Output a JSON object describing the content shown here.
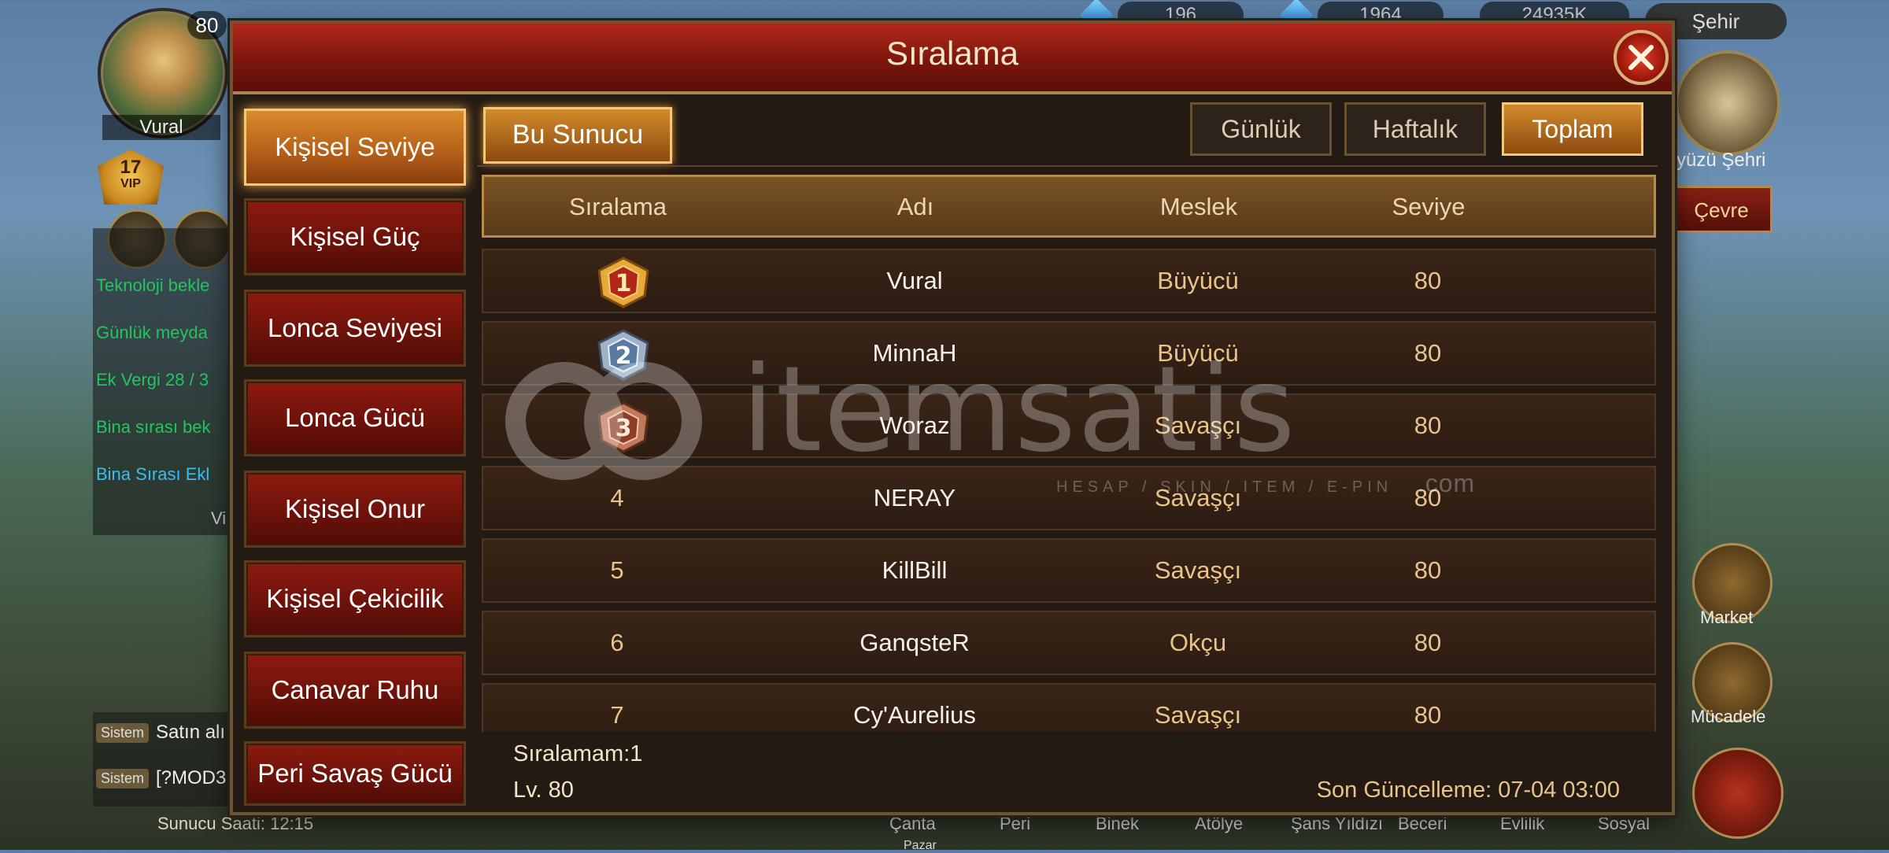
{
  "hud": {
    "player_level": "80",
    "player_name": "Vural",
    "vip_level": "17",
    "vip_label": "VIP",
    "resources": [
      "196",
      "1964",
      "24935K"
    ],
    "city_chip": "Şehir",
    "city_name": "kyüzü Şehri",
    "cevre_button": "Çevre",
    "quests": [
      {
        "text": "Teknoloji bekle",
        "color": "#22c55e"
      },
      {
        "text": "Günlük meyda",
        "color": "#22c55e"
      },
      {
        "text": "Ek Vergi 28 / 3",
        "color": "#22c55e"
      },
      {
        "text": "Bina sırası bek",
        "color": "#22c55e"
      },
      {
        "text": "Bina Sırası Ekl",
        "color": "#38bdf8"
      },
      {
        "text": "Vi",
        "color": "#cccccc"
      }
    ],
    "chat": [
      {
        "tag": "Sistem",
        "text": "Satın alı"
      },
      {
        "tag": "Sistem",
        "text": "[?MOD3"
      }
    ],
    "server_time": "Sunucu Saati: 12:15",
    "side_buttons": [
      "Market",
      "Mücadele"
    ],
    "bottom_menu": [
      "Çanta",
      "Peri",
      "Binek",
      "Atölye",
      "Şans Yıldızı",
      "Beceri",
      "Evlilik",
      "Sosyal"
    ],
    "bottom_extra": "Pazar"
  },
  "modal": {
    "title": "Sıralama",
    "sidebar": [
      {
        "label": "Kişisel Seviye",
        "active": true
      },
      {
        "label": "Kişisel Güç",
        "active": false
      },
      {
        "label": "Lonca Seviyesi",
        "active": false
      },
      {
        "label": "Lonca Gücü",
        "active": false
      },
      {
        "label": "Kişisel Onur",
        "active": false
      },
      {
        "label": "Kişisel Çekicilik",
        "active": false
      },
      {
        "label": "Canavar Ruhu",
        "active": false
      },
      {
        "label": "Peri Savaş Gücü",
        "active": false
      }
    ],
    "server_tab": "Bu Sunucu",
    "periods": [
      {
        "label": "Günlük",
        "active": false
      },
      {
        "label": "Haftalık",
        "active": false
      },
      {
        "label": "Toplam",
        "active": true
      }
    ],
    "columns": [
      "Sıralama",
      "Adı",
      "Meslek",
      "Seviye"
    ],
    "rows": [
      {
        "rank": "1",
        "name": "Vural",
        "job": "Büyücü",
        "level": "80",
        "medal": "gold"
      },
      {
        "rank": "2",
        "name": "MinnaH",
        "job": "Büyücü",
        "level": "80",
        "medal": "silver"
      },
      {
        "rank": "3",
        "name": "Woraz",
        "job": "Savaşçı",
        "level": "80",
        "medal": "bronze"
      },
      {
        "rank": "4",
        "name": "NERAY",
        "job": "Savaşçı",
        "level": "80",
        "medal": ""
      },
      {
        "rank": "5",
        "name": "KillBill",
        "job": "Savaşçı",
        "level": "80",
        "medal": ""
      },
      {
        "rank": "6",
        "name": "GanqsteR",
        "job": "Okçu",
        "level": "80",
        "medal": ""
      },
      {
        "rank": "7",
        "name": "Cy'Aurelius",
        "job": "Savaşçı",
        "level": "80",
        "medal": ""
      }
    ],
    "footer": {
      "my_rank": "Sıralamam:1",
      "my_level": "Lv. 80",
      "last_update": "Son Güncelleme: 07-04 03:00"
    }
  },
  "watermark": {
    "brand": "itemsatis",
    "tagline": "HESAP / SKIN / ITEM / E-PIN",
    "suffix": ".com"
  },
  "colors": {
    "header_red": "#8e1a0f",
    "active_gold": "#d18b2c",
    "text_gold": "#e8c38a",
    "gold_medal": "#e6a93a",
    "silver_medal": "#9fb2c9",
    "bronze_medal": "#c07a5a"
  }
}
